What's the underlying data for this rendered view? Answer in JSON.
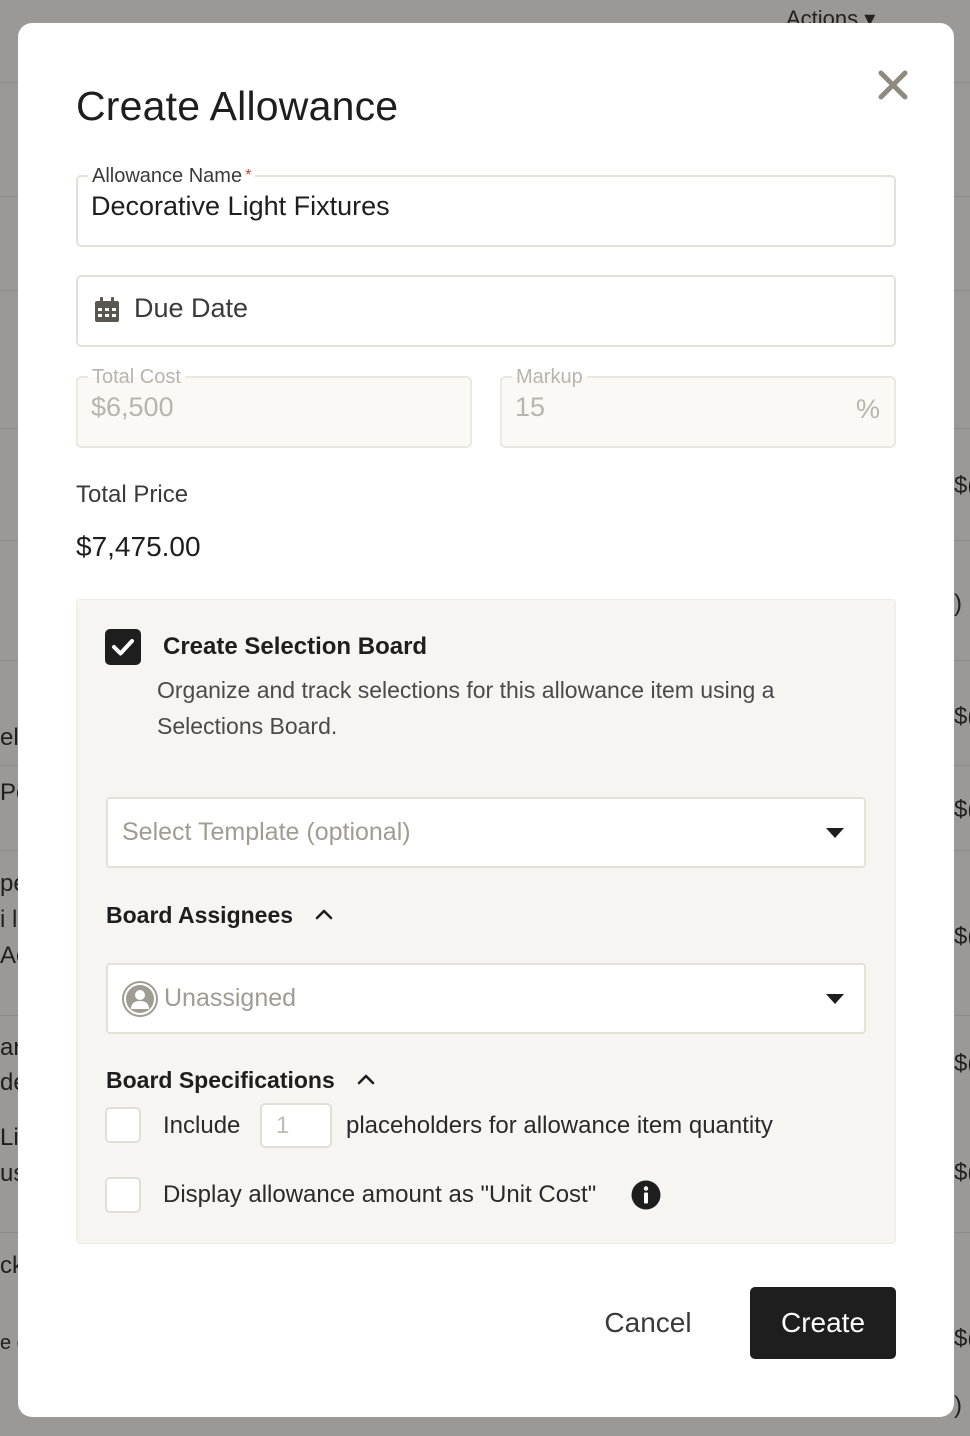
{
  "background": {
    "actions_label": "Actions",
    "edge_fragments": [
      "ele",
      "Pe",
      "pe",
      "i l",
      "Ac",
      "ar",
      "de",
      "Li",
      "us",
      "ck",
      "e c"
    ],
    "right_fragments": [
      "$(",
      ") (",
      "$(",
      "$(",
      "$(",
      "$(",
      "$(",
      "$(",
      "$(",
      ") ("
    ]
  },
  "modal": {
    "title": "Create Allowance",
    "close_icon": "close-icon",
    "allowance_name": {
      "label": "Allowance Name",
      "required_mark": "*",
      "value": "Decorative Light Fixtures"
    },
    "due_date": {
      "placeholder": "Due Date",
      "icon": "calendar-icon"
    },
    "total_cost": {
      "label": "Total Cost",
      "value": "$6,500"
    },
    "markup": {
      "label": "Markup",
      "value": "15",
      "suffix": "%"
    },
    "total_price": {
      "label": "Total Price",
      "value": "$7,475.00"
    },
    "selection_board": {
      "checked": true,
      "heading": "Create Selection Board",
      "description": "Organize and track selections for this allowance item using a Selections Board.",
      "template_select": {
        "placeholder": "Select Template (optional)"
      },
      "assignees": {
        "heading": "Board Assignees",
        "selected": "Unassigned"
      },
      "specifications": {
        "heading": "Board Specifications",
        "include_label": "Include",
        "placeholder_qty": "1",
        "placeholder_suffix": "placeholders for allowance item quantity",
        "unit_cost_label": "Display allowance amount as \"Unit Cost\""
      }
    },
    "actions": {
      "cancel_label": "Cancel",
      "create_label": "Create"
    }
  },
  "colors": {
    "primary": "#1e1e1e",
    "border": "#e4e1d9",
    "panel_bg": "#f6f5f2",
    "required": "#d43b2a",
    "muted": "#b9b5ac"
  }
}
